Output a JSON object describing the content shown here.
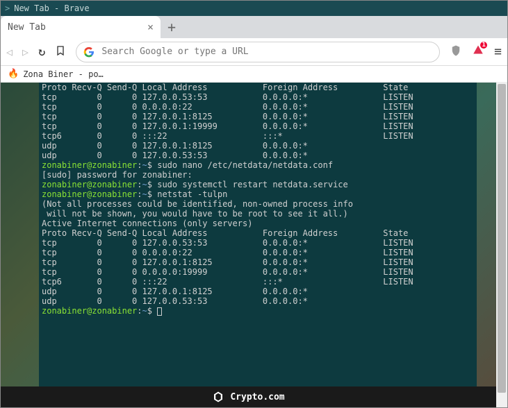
{
  "titlebar": {
    "text": "New Tab - Brave"
  },
  "tab": {
    "title": "New Tab"
  },
  "omnibox": {
    "placeholder": "Search Google or type a URL"
  },
  "ext_badge": "1",
  "bookmark": {
    "label": "Zona Biner - po…"
  },
  "footer": {
    "text": "Crypto.com"
  },
  "terminal": {
    "header": "Proto Recv-Q Send-Q Local Address           Foreign Address         State",
    "rows1": [
      "tcp        0      0 127.0.0.53:53           0.0.0.0:*               LISTEN",
      "tcp        0      0 0.0.0.0:22              0.0.0.0:*               LISTEN",
      "tcp        0      0 127.0.0.1:8125          0.0.0.0:*               LISTEN",
      "tcp        0      0 127.0.0.1:19999         0.0.0.0:*               LISTEN",
      "tcp6       0      0 :::22                   :::*                    LISTEN",
      "udp        0      0 127.0.0.1:8125          0.0.0.0:*",
      "udp        0      0 127.0.0.53:53           0.0.0.0:*"
    ],
    "prompt": {
      "userhost": "zonabiner@zonabiner",
      "sep": ":",
      "path": "~",
      "dollar": "$"
    },
    "cmd1": "sudo nano /etc/netdata/netdata.conf",
    "sudo_line": "[sudo] password for zonabiner:",
    "cmd2": "sudo systemctl restart netdata.service",
    "cmd3": "netstat -tulpn",
    "note1": "(Not all processes could be identified, non-owned process info",
    "note2": " will not be shown, you would have to be root to see it all.)",
    "active": "Active Internet connections (only servers)",
    "rows2": [
      "tcp        0      0 127.0.0.53:53           0.0.0.0:*               LISTEN",
      "tcp        0      0 0.0.0.0:22              0.0.0.0:*               LISTEN",
      "tcp        0      0 127.0.0.1:8125          0.0.0.0:*               LISTEN",
      "tcp        0      0 0.0.0.0:19999           0.0.0.0:*               LISTEN",
      "tcp6       0      0 :::22                   :::*                    LISTEN",
      "udp        0      0 127.0.0.1:8125          0.0.0.0:*",
      "udp        0      0 127.0.0.53:53           0.0.0.0:*"
    ]
  }
}
